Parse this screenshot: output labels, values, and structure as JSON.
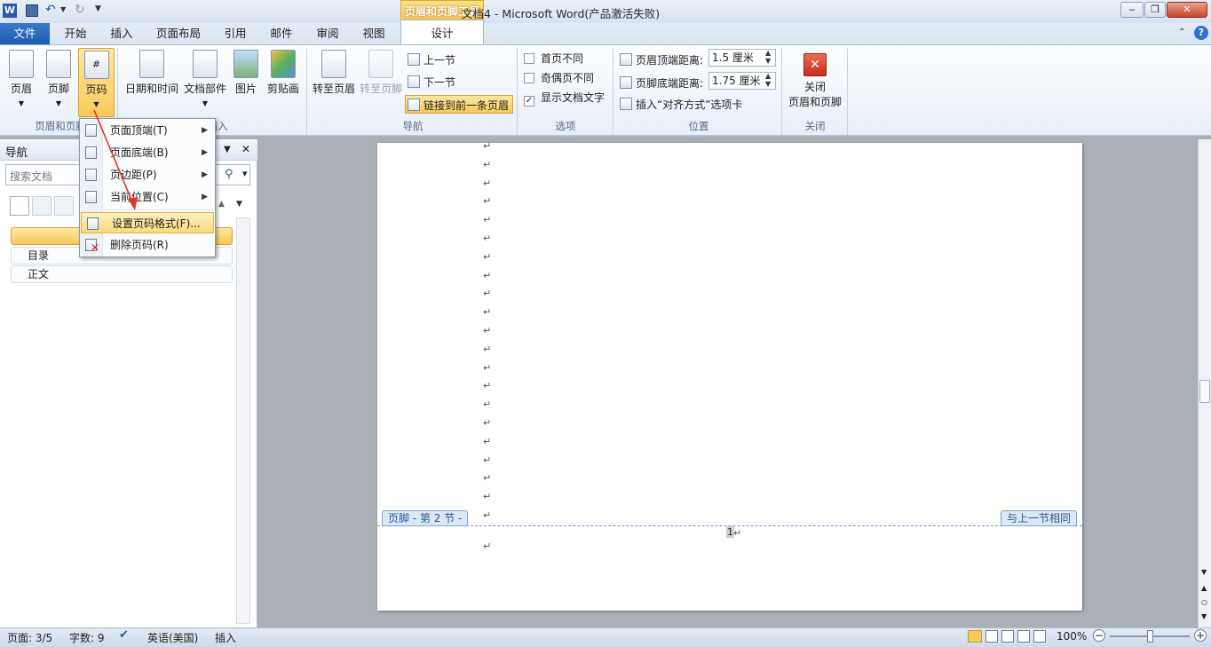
{
  "titlebar": {
    "title": "文档4  -  Microsoft Word(产品激活失败)",
    "context_tab": "页眉和页脚工具"
  },
  "tabs": {
    "file": "文件",
    "items": [
      "开始",
      "插入",
      "页面布局",
      "引用",
      "邮件",
      "审阅",
      "视图"
    ],
    "design": "设计"
  },
  "ribbon": {
    "header_footer": {
      "header": "页眉",
      "footer": "页脚",
      "page_number": "页码",
      "group": "页眉和页脚"
    },
    "insert": {
      "datetime": "日期和时间",
      "doc_parts": "文档部件",
      "picture": "图片",
      "clipart": "剪贴画",
      "group": "插入"
    },
    "navigation": {
      "goto_header": "转至页眉",
      "goto_footer": "转至页脚",
      "prev": "上一节",
      "next": "下一节",
      "link_prev": "链接到前一条页眉",
      "group": "导航"
    },
    "options": {
      "first_page": "首页不同",
      "odd_even": "奇偶页不同",
      "show_text": "显示文档文字",
      "group": "选项",
      "first_checked": false,
      "odd_checked": false,
      "show_checked": true
    },
    "position": {
      "header_label": "页眉顶端距离:",
      "header_value": "1.5 厘米",
      "footer_label": "页脚底端距离:",
      "footer_value": "1.75 厘米",
      "align_tab": "插入“对齐方式”选项卡",
      "group": "位置"
    },
    "close": {
      "label1": "关闭",
      "label2": "页眉和页脚",
      "group": "关闭"
    }
  },
  "nav": {
    "title": "导航",
    "search_placeholder": "搜索文档",
    "items": [
      "",
      "目录",
      "正文"
    ]
  },
  "menu": {
    "items": [
      {
        "label": "页面顶端(T)",
        "submenu": true
      },
      {
        "label": "页面底端(B)",
        "submenu": true
      },
      {
        "label": "页边距(P)",
        "submenu": true
      },
      {
        "label": "当前位置(C)",
        "submenu": true
      },
      {
        "label": "设置页码格式(F)...",
        "submenu": false
      },
      {
        "label": "删除页码(R)",
        "submenu": false
      }
    ]
  },
  "document": {
    "footer_tag": "页脚 - 第 2 节 -",
    "same_as_prev": "与上一节相同",
    "para_mark": "↵",
    "page_number": "1"
  },
  "status": {
    "page": "页面: 3/5",
    "words": "字数: 9",
    "language": "英语(美国)",
    "mode": "插入",
    "zoom": "100%"
  },
  "colors": {
    "accent": "#2b5797",
    "highlight": "#fbd97a",
    "file_tab": "#2a68bd"
  }
}
